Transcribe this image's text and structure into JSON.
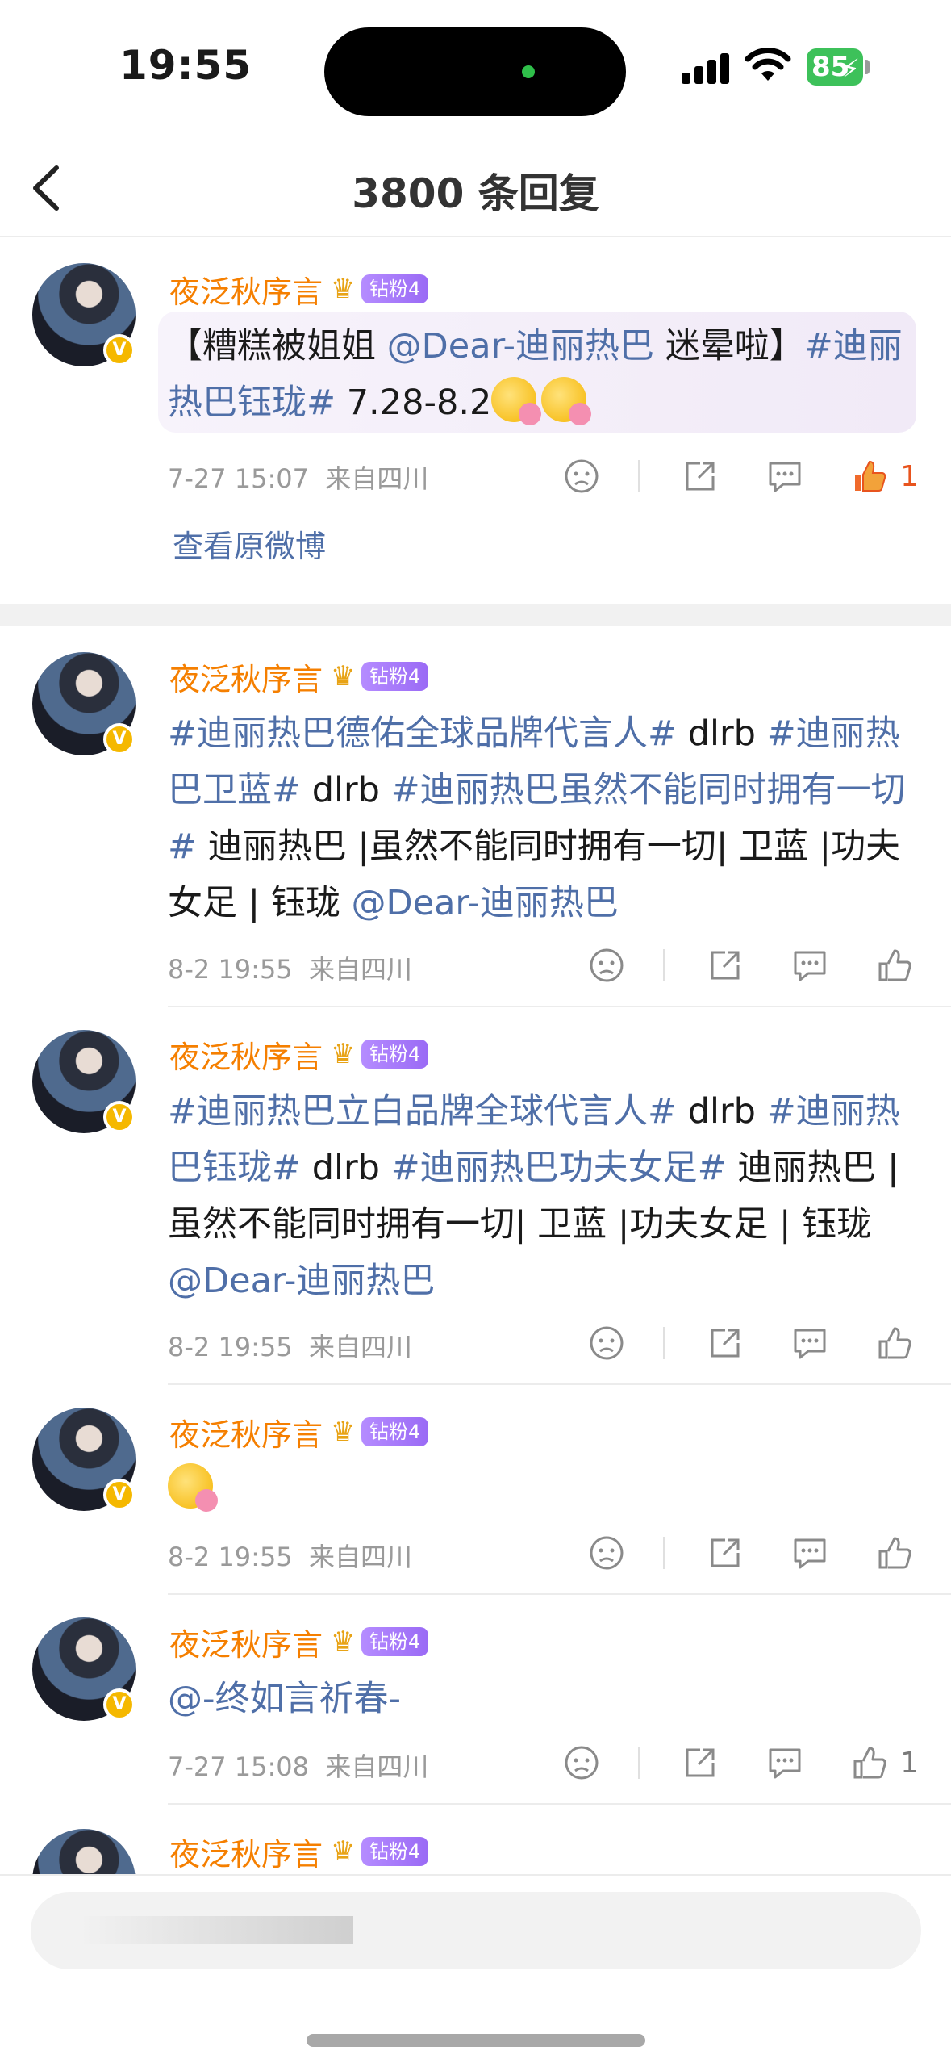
{
  "status_bar": {
    "time": "19:55",
    "battery": "85"
  },
  "header": {
    "title": "3800 条回复"
  },
  "comments": [
    {
      "username": "夜泛秋序言",
      "fan_badge": "钻粉4",
      "text_parts": [
        "【糟糕被姐姐 ",
        "@Dear-迪丽热巴",
        " 迷晕啦】",
        "#迪丽热巴钰珑#",
        " 7.28-8.2"
      ],
      "date": "7-27 15:07",
      "location": "来自四川",
      "likes": "1",
      "view_original": "查看原微博"
    },
    {
      "username": "夜泛秋序言",
      "fan_badge": "钻粉4",
      "text_parts": [
        "#迪丽热巴德佑全球品牌代言人#",
        " dlrb ",
        "#迪丽热巴卫蓝#",
        " dlrb ",
        "#迪丽热巴虽然不能同时拥有一切#",
        " 迪丽热巴 |虽然不能同时拥有一切| 卫蓝  |功夫女足 | 钰珑 ",
        "@Dear-迪丽热巴"
      ],
      "date": "8-2 19:55",
      "location": "来自四川"
    },
    {
      "username": "夜泛秋序言",
      "fan_badge": "钻粉4",
      "text_parts": [
        "#迪丽热巴立白品牌全球代言人#",
        " dlrb ",
        "#迪丽热巴钰珑#",
        " dlrb ",
        "#迪丽热巴功夫女足#",
        " 迪丽热巴 |虽然不能同时拥有一切| 卫蓝  |功夫女足 | 钰珑 ",
        "@Dear-迪丽热巴"
      ],
      "date": "8-2 19:55",
      "location": "来自四川"
    },
    {
      "username": "夜泛秋序言",
      "fan_badge": "钻粉4",
      "date": "8-2 19:55",
      "location": "来自四川"
    },
    {
      "username": "夜泛秋序言",
      "fan_badge": "钻粉4",
      "text_parts": [
        "@-终如言祈春-"
      ],
      "date": "7-27 15:08",
      "location": "来自四川",
      "likes": "1"
    },
    {
      "username": "夜泛秋序言",
      "fan_badge": "钻粉4"
    }
  ],
  "icons": [
    "back-arrow-icon",
    "dislike-face-icon",
    "share-icon",
    "comment-icon",
    "like-thumb-icon",
    "verified-v-icon",
    "crown-icon"
  ],
  "colors": {
    "username": "#f57f00",
    "link": "#4f6fa8",
    "like_active": "#e8541e",
    "fan_badge": "#9a6af5"
  }
}
